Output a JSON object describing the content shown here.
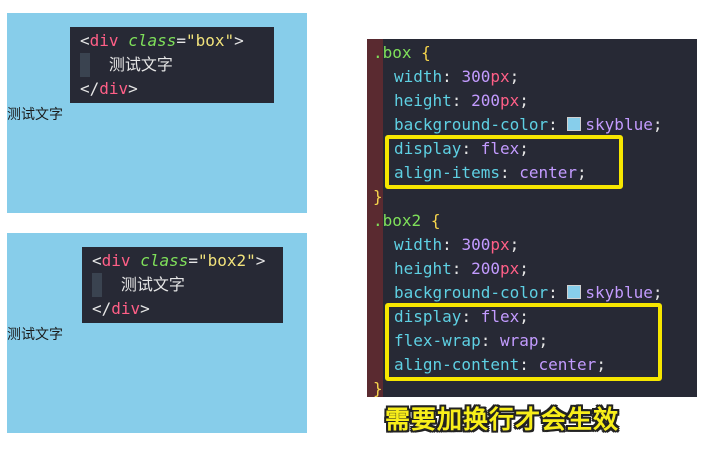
{
  "demo1": {
    "text": "测试文字",
    "snippet": {
      "open_lt": "<",
      "open_tag": "div",
      "attr": "class",
      "eq": "=",
      "value": "\"box\"",
      "open_gt": ">",
      "inner": "测试文字",
      "close_lt": "</",
      "close_tag": "div",
      "close_gt": ">"
    }
  },
  "demo2": {
    "text": "测试文字",
    "snippet": {
      "open_lt": "<",
      "open_tag": "div",
      "attr": "class",
      "eq": "=",
      "value": "\"box2\"",
      "open_gt": ">",
      "inner": "测试文字",
      "close_lt": "</",
      "close_tag": "div",
      "close_gt": ">"
    }
  },
  "css_code": {
    "rule1": {
      "selector": ".box",
      "open": "{",
      "width_prop": "width",
      "width_num": "300",
      "width_unit": "px",
      "height_prop": "height",
      "height_num": "200",
      "height_unit": "px",
      "bg_prop": "background-color",
      "bg_value": "skyblue",
      "display_prop": "display",
      "display_value": "flex",
      "align_prop": "align-items",
      "align_value": "center",
      "close": "}"
    },
    "rule2": {
      "selector": ".box2",
      "open": "{",
      "width_prop": "width",
      "width_num": "300",
      "width_unit": "px",
      "height_prop": "height",
      "height_num": "200",
      "height_unit": "px",
      "bg_prop": "background-color",
      "bg_value": "skyblue",
      "display_prop": "display",
      "display_value": "flex",
      "wrap_prop": "flex-wrap",
      "wrap_value": "wrap",
      "ac_prop": "align-content",
      "ac_value": "center",
      "close": "}"
    },
    "colon": ":",
    "semi": ";"
  },
  "caption": "需要加换行才会生效",
  "colors": {
    "box_bg": "#87cdea",
    "editor_bg": "#272935",
    "highlight": "#f6e600",
    "caption": "#f8ee1a"
  }
}
